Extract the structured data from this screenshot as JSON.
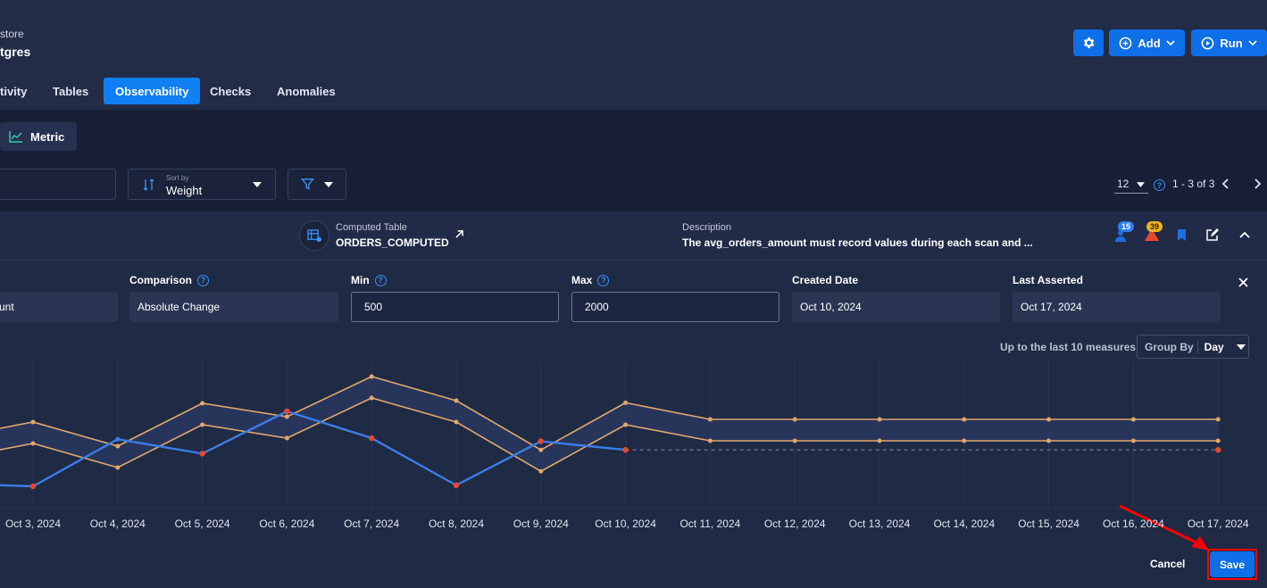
{
  "header": {
    "crumb": "store",
    "datastore_name": "tgres"
  },
  "actions": {
    "add_label": "Add",
    "run_label": "Run"
  },
  "tabs": [
    {
      "label": "tivity",
      "active": false
    },
    {
      "label": "Tables",
      "active": false
    },
    {
      "label": "Observability",
      "active": true
    },
    {
      "label": "Checks",
      "active": false
    },
    {
      "label": "Anomalies",
      "active": false
    }
  ],
  "subnav": {
    "metric_label": "Metric"
  },
  "filters": {
    "sort_caption": "Sort by",
    "sort_value": "Weight"
  },
  "pagination": {
    "page_size": "12",
    "range": "1 - 3 of 3"
  },
  "card": {
    "table_caption": "Computed Table",
    "table_name": "ORDERS_COMPUTED",
    "description_caption": "Description",
    "description": "The avg_orders_amount must record values during each scan and ...",
    "badge_info_count": "15",
    "badge_anomaly_count": "39"
  },
  "form": {
    "field_value_partial": "unt",
    "comparison_label": "Comparison",
    "comparison_value": "Absolute Change",
    "min_label": "Min",
    "min_value": "500",
    "max_label": "Max",
    "max_value": "2000",
    "created_label": "Created Date",
    "created_value": "Oct 10, 2024",
    "asserted_label": "Last Asserted",
    "asserted_value": "Oct 17, 2024"
  },
  "chart_controls": {
    "measure_text": "Up to the last 10 measures",
    "group_by_label": "Group By",
    "group_by_value": "Day"
  },
  "footer": {
    "cancel_label": "Cancel",
    "save_label": "Save"
  },
  "colors": {
    "accent": "#0f7ff2",
    "actual": "#3b7de8",
    "bounds": "#e0a86e",
    "anomaly": "#e8472e",
    "highlight": "#ff0000"
  },
  "chart_data": {
    "type": "line",
    "categories": [
      "Oct 3, 2024",
      "Oct 4, 2024",
      "Oct 5, 2024",
      "Oct 6, 2024",
      "Oct 7, 2024",
      "Oct 8, 2024",
      "Oct 9, 2024",
      "Oct 10, 2024",
      "Oct 11, 2024",
      "Oct 12, 2024",
      "Oct 13, 2024",
      "Oct 14, 2024",
      "Oct 15, 2024",
      "Oct 16, 2024",
      "Oct 17, 2024"
    ],
    "lead_in": {
      "actual": 45,
      "upper": 130,
      "lower": 90
    },
    "series": [
      {
        "values": [
          40,
          128,
          101,
          180,
          130,
          42,
          124,
          108,
          null,
          null,
          null,
          null,
          null,
          null,
          108
        ]
      },
      {
        "values": [
          160,
          115,
          195,
          170,
          245,
          200,
          108,
          196,
          165,
          165,
          165,
          165,
          165,
          165,
          165
        ]
      },
      {
        "values": [
          120,
          75,
          155,
          130,
          205,
          160,
          68,
          155,
          125,
          125,
          125,
          125,
          125,
          125,
          125
        ]
      }
    ],
    "anomaly_points": [
      0,
      2,
      3,
      4,
      5,
      6,
      14
    ],
    "projection_from": 7,
    "ylim": [
      0,
      280
    ],
    "grid": true
  }
}
